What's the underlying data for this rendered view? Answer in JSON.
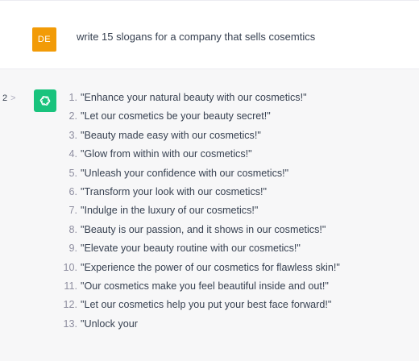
{
  "user_message": {
    "avatar_initials": "DE",
    "text": "write 15 slogans for a company that sells cosemtics"
  },
  "assistant_message": {
    "pager_label": "2",
    "pager_arrow": ">",
    "avatar_icon": "openai-logo-icon",
    "slogans": [
      {
        "num": "1.",
        "text": "\"Enhance your natural beauty with our cosmetics!\""
      },
      {
        "num": "2.",
        "text": "\"Let our cosmetics be your beauty secret!\""
      },
      {
        "num": "3.",
        "text": "\"Beauty made easy with our cosmetics!\""
      },
      {
        "num": "4.",
        "text": "\"Glow from within with our cosmetics!\""
      },
      {
        "num": "5.",
        "text": "\"Unleash your confidence with our cosmetics!\""
      },
      {
        "num": "6.",
        "text": "\"Transform your look with our cosmetics!\""
      },
      {
        "num": "7.",
        "text": "\"Indulge in the luxury of our cosmetics!\""
      },
      {
        "num": "8.",
        "text": "\"Beauty is our passion, and it shows in our cosmetics!\""
      },
      {
        "num": "9.",
        "text": "\"Elevate your beauty routine with our cosmetics!\""
      },
      {
        "num": "10.",
        "text": "\"Experience the power of our cosmetics for flawless skin!\""
      },
      {
        "num": "11.",
        "text": "\"Our cosmetics make you feel beautiful inside and out!\""
      },
      {
        "num": "12.",
        "text": "\"Let our cosmetics help you put your best face forward!\""
      },
      {
        "num": "13.",
        "text": "\"Unlock your"
      }
    ]
  },
  "colors": {
    "user_avatar_bg": "#f29b07",
    "assistant_avatar_bg": "#19c37d",
    "assistant_row_bg": "#f7f7f8"
  }
}
